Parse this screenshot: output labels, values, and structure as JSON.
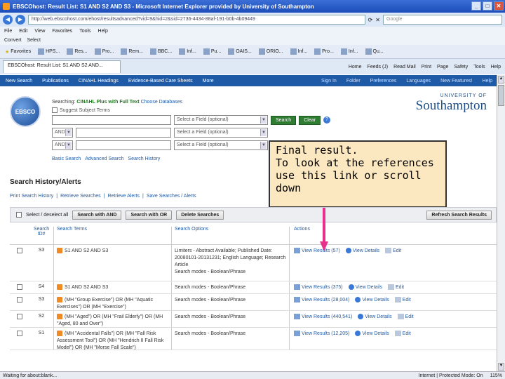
{
  "window": {
    "title": "EBSCOhost: Result List: S1 AND S2 AND S3 - Microsoft Internet Explorer provided by University of Southampton"
  },
  "address": {
    "url": "http://web.ebscohost.com/ehost/resultsadvanced?vid=9&hid=2&sid=2736-4434-88af-191-b0b-4b09449",
    "search_placeholder": "Google"
  },
  "menu": [
    "File",
    "Edit",
    "View",
    "Favorites",
    "Tools",
    "Help"
  ],
  "convert": {
    "convert_label": "Convert",
    "select_label": "Select"
  },
  "favorites": {
    "label": "Favorites",
    "items": [
      "HPS...",
      "Res...",
      "Pro...",
      "Rem...",
      "BBC...",
      "Inf...",
      "Pu...",
      "OAIS...",
      "ORIO...",
      "Inf...",
      "Pro...",
      "Inf...",
      "Qu..."
    ]
  },
  "tab": {
    "label": "EBSCOhost: Result List: S1 AND S2 AND..."
  },
  "commands": [
    "Home",
    "Feeds (J)",
    "Read Mail",
    "Print",
    "Page",
    "Safety",
    "Tools",
    "Help"
  ],
  "ebsco_nav": {
    "left": [
      "New Search",
      "Publications",
      "CINAHL Headings",
      "Evidence-Based Care Sheets",
      "More"
    ],
    "right": [
      "Sign In",
      "Folder",
      "Preferences",
      "Languages",
      "New Features!",
      "Help"
    ]
  },
  "logo": {
    "text": "EBSCO"
  },
  "search": {
    "searching_label": "Searching:",
    "database": "CINAHL Plus with Full Text",
    "choose_db": "Choose Databases",
    "suggest": "Suggest Subject Terms",
    "field_placeholder": "Select a Field (optional)",
    "bool_and": "AND",
    "search_btn": "Search",
    "clear_btn": "Clear",
    "help_icon": "?",
    "basic": "Basic Search",
    "advanced": "Advanced Search",
    "history": "Search History"
  },
  "university": {
    "top": "UNIVERSITY OF",
    "name": "Southampton"
  },
  "callout": {
    "lines": [
      "Final result.",
      "To look at the references",
      "use this link or scroll down"
    ]
  },
  "history": {
    "title": "Search History/Alerts",
    "links": [
      "Print Search History",
      "Retrieve Searches",
      "Retrieve Alerts",
      "Save Searches / Alerts"
    ],
    "toolbar": {
      "select_all": "Select / deselect all",
      "with_and": "Search with AND",
      "with_or": "Search with OR",
      "delete": "Delete Searches",
      "refresh": "Refresh Search Results"
    },
    "columns": {
      "search_id": "Search ID#",
      "terms": "Search Terms",
      "options": "Search Options",
      "actions": "Actions"
    },
    "rows": [
      {
        "id": "S3",
        "terms": "S1 AND S2 AND S3",
        "options": "Limiters - Abstract Available; Published Date: 20080101-20131231; English Language; Research Article",
        "mode": "Search modes - Boolean/Phrase",
        "view": "View Results (57)",
        "details": "View Details",
        "edit": "Edit"
      },
      {
        "id": "S4",
        "terms": "S1 AND S2 AND S3",
        "options": "",
        "mode": "Search modes - Boolean/Phrase",
        "view": "View Results (375)",
        "details": "View Details",
        "edit": "Edit"
      },
      {
        "id": "S3",
        "terms": "(MH \"Group Exercise\") OR (MH \"Aquatic Exercises\") OR (MH \"Exercise\")",
        "options": "",
        "mode": "Search modes - Boolean/Phrase",
        "view": "View Results (28,004)",
        "details": "View Details",
        "edit": "Edit"
      },
      {
        "id": "S2",
        "terms": "(MH \"Aged\") OR (MH \"Frail Elderly\") OR (MH \"Aged, 80 and Over\")",
        "options": "",
        "mode": "Search modes - Boolean/Phrase",
        "view": "View Results (440,541)",
        "details": "View Details",
        "edit": "Edit"
      },
      {
        "id": "S1",
        "terms": "(MH \"Accidental Falls\") OR (MH \"Fall Risk Assessment Tool\") OR (MH \"Hendrich II Fall Risk Model\") OR (MH \"Morse Fall Scale\")",
        "options": "",
        "mode": "Search modes - Boolean/Phrase",
        "view": "View Results (12,205)",
        "details": "View Details",
        "edit": "Edit"
      }
    ]
  },
  "status": {
    "left": "Waiting for about:blank...",
    "zone": "Internet | Protected Mode: On",
    "zoom": "115%"
  }
}
